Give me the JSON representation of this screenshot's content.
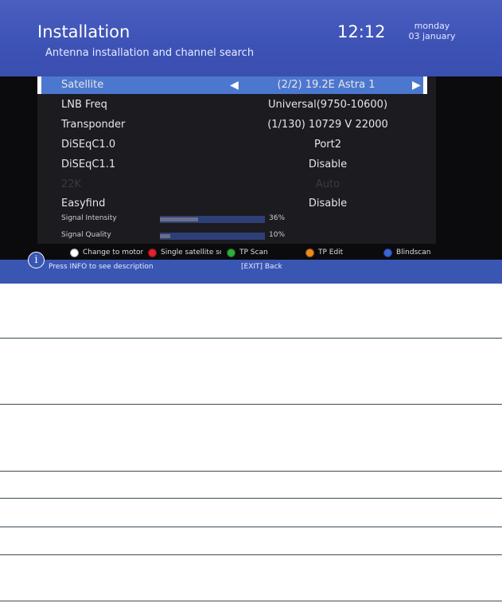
{
  "header": {
    "title": "Installation",
    "subtitle": "Antenna installation and channel search",
    "time": "12:12",
    "day": "monday",
    "date": "03 january"
  },
  "menu": {
    "rows": [
      {
        "label": "Satellite",
        "value": "(2/2) 19.2E Astra 1",
        "selected": true
      },
      {
        "label": "LNB Freq",
        "value": "Universal(9750-10600)"
      },
      {
        "label": "Transponder",
        "value": "(1/130) 10729 V 22000"
      },
      {
        "label": "DiSEqC1.0",
        "value": "Port2"
      },
      {
        "label": "DiSEqC1.1",
        "value": "Disable"
      },
      {
        "label": "22K",
        "value": "Auto",
        "disabled": true
      },
      {
        "label": "Easyfind",
        "value": "Disable"
      }
    ],
    "left_arrow": "◀",
    "right_arrow": "▶"
  },
  "meters": [
    {
      "label": "Signal Intensity",
      "percent": 36,
      "text": "36%"
    },
    {
      "label": "Signal Quality",
      "percent": 10,
      "text": "10%"
    }
  ],
  "legend": [
    {
      "color": "#ffffff",
      "label": "Change to motor"
    },
    {
      "color": "#e0222a",
      "label": "Single satellite scan"
    },
    {
      "color": "#2eae3a",
      "label": "TP Scan"
    },
    {
      "color": "#f08a1c",
      "label": "TP Edit"
    },
    {
      "color": "#3a64d8",
      "label": "Blindscan"
    }
  ],
  "footer": {
    "info_icon": "i",
    "info_text": "Press INFO to see description",
    "exit_text": "[EXIT] Back"
  },
  "colors": {
    "header_blue": "#3d52b5",
    "selected_row": "#4c77cf",
    "footer_blue": "#3a56b3"
  }
}
